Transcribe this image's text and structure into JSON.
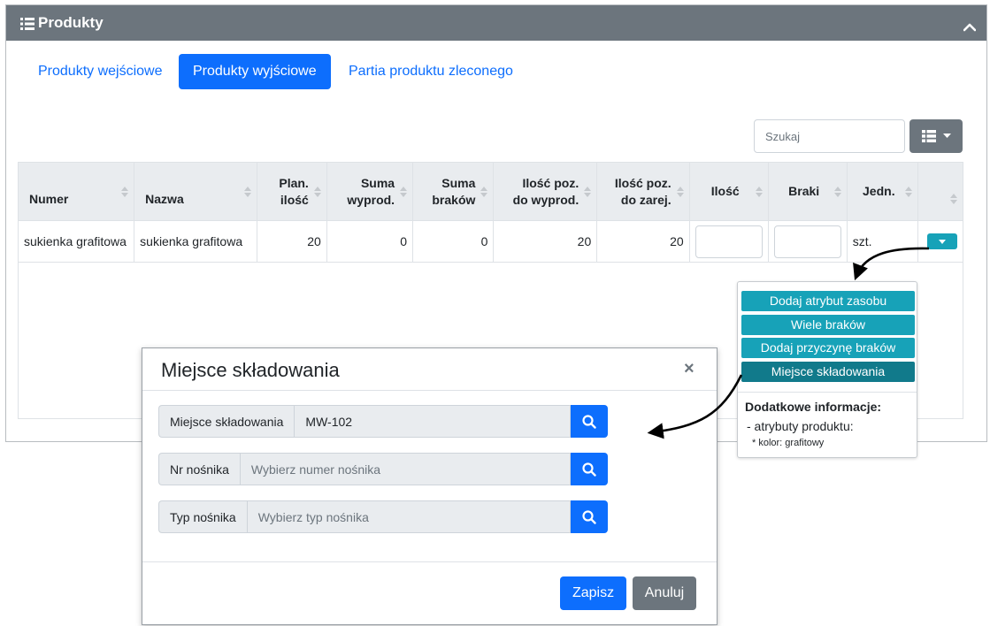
{
  "panel": {
    "title": "Produkty"
  },
  "tabs": [
    {
      "label": "Produkty wejściowe",
      "active": false
    },
    {
      "label": "Produkty wyjściowe",
      "active": true
    },
    {
      "label": "Partia produktu zleconego",
      "active": false
    }
  ],
  "search": {
    "placeholder": "Szukaj"
  },
  "table": {
    "headers": {
      "numer": "Numer",
      "nazwa": "Nazwa",
      "plan_ilosc": [
        "Plan.",
        "ilość"
      ],
      "suma_wyprod": [
        "Suma",
        "wyprod."
      ],
      "suma_brakow": [
        "Suma",
        "braków"
      ],
      "ilosc_poz_wyprod": [
        "Ilość poz.",
        "do wyprod."
      ],
      "ilosc_poz_zarej": [
        "Ilość poz.",
        "do zarej."
      ],
      "ilosc": "Ilość",
      "braki": "Braki",
      "jedn": "Jedn."
    },
    "rows": [
      {
        "numer": "sukienka grafitowa",
        "nazwa": "sukienka grafitowa",
        "plan_ilosc": "20",
        "suma_wyprod": "0",
        "suma_brakow": "0",
        "ilosc_poz_wyprod": "20",
        "ilosc_poz_zarej": "20",
        "jedn": "szt."
      }
    ]
  },
  "dropdown": {
    "items": [
      {
        "label": "Dodaj atrybut zasobu",
        "active": false
      },
      {
        "label": "Wiele braków",
        "active": false
      },
      {
        "label": "Dodaj przyczynę braków",
        "active": false
      },
      {
        "label": "Miejsce składowania",
        "active": true
      }
    ],
    "info_title": "Dodatkowe informacje:",
    "info_line": "- atrybuty produktu:",
    "info_sub": "* kolor: grafitowy"
  },
  "modal": {
    "title": "Miejsce składowania",
    "close": "×",
    "fields": [
      {
        "label": "Miejsce składowania",
        "value": "MW-102",
        "placeholder": ""
      },
      {
        "label": "Nr nośnika",
        "value": "",
        "placeholder": "Wybierz numer nośnika"
      },
      {
        "label": "Typ nośnika",
        "value": "",
        "placeholder": "Wybierz typ nośnika"
      }
    ],
    "save_label": "Zapisz",
    "cancel_label": "Anuluj"
  },
  "colors": {
    "primary": "#0d6efd",
    "secondary": "#6c757d",
    "info": "#17a2b8",
    "info_dark": "#117a8b"
  }
}
